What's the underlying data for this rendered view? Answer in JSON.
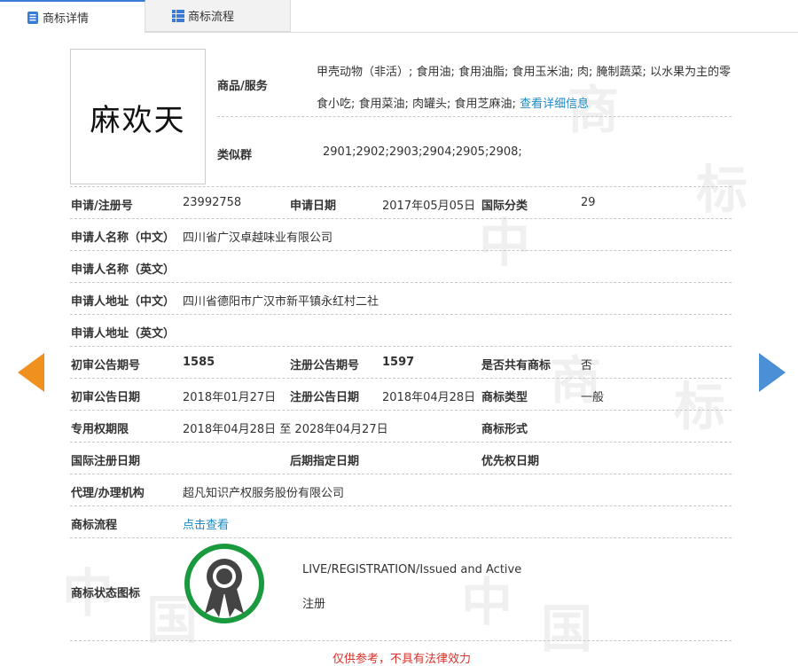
{
  "tabs": [
    {
      "label": "商标详情",
      "icon": "document-icon"
    },
    {
      "label": "商标流程",
      "icon": "list-icon"
    }
  ],
  "logo": {
    "text": "麻欢天"
  },
  "watermark": {
    "chars": [
      "中",
      "国",
      "商",
      "标"
    ]
  },
  "goods": {
    "label": "商品/服务",
    "text": "甲壳动物（非活）; 食用油; 食用油脂; 食用玉米油; 肉; 腌制蔬菜; 以水果为主的零食小吃; 食用菜油; 肉罐头; 食用芝麻油;",
    "link": "查看详细信息"
  },
  "similar": {
    "label": "类似群",
    "value": "2901;2902;2903;2904;2905;2908;"
  },
  "rows": {
    "reg_no": {
      "label": "申请/注册号",
      "value": "23992758"
    },
    "app_date": {
      "label": "申请日期",
      "value": "2017年05月05日"
    },
    "intl_class": {
      "label": "国际分类",
      "value": "29"
    },
    "applicant_cn": {
      "label": "申请人名称（中文）",
      "value": "四川省广汉卓越味业有限公司"
    },
    "applicant_en": {
      "label": "申请人名称（英文）",
      "value": ""
    },
    "address_cn": {
      "label": "申请人地址（中文）",
      "value": "四川省德阳市广汉市新平镇永红村二社"
    },
    "address_en": {
      "label": "申请人地址（英文）",
      "value": ""
    },
    "prelim_no": {
      "label": "初审公告期号",
      "value": "1585"
    },
    "reg_pub_no": {
      "label": "注册公告期号",
      "value": "1597"
    },
    "shared": {
      "label": "是否共有商标",
      "value": "否"
    },
    "prelim_date": {
      "label": "初审公告日期",
      "value": "2018年01月27日"
    },
    "reg_pub_date": {
      "label": "注册公告日期",
      "value": "2018年04月28日"
    },
    "mark_type": {
      "label": "商标类型",
      "value": "一般"
    },
    "exclusive": {
      "label": "专用权期限",
      "value": "2018年04月28日 至 2028年04月27日"
    },
    "mark_form": {
      "label": "商标形式",
      "value": ""
    },
    "intl_reg_date": {
      "label": "国际注册日期",
      "value": ""
    },
    "later_date": {
      "label": "后期指定日期",
      "value": ""
    },
    "priority_date": {
      "label": "优先权日期",
      "value": ""
    },
    "agent": {
      "label": "代理/办理机构",
      "value": "超凡知识产权服务股份有限公司"
    },
    "flow": {
      "label": "商标流程",
      "link": "点击查看"
    },
    "status": {
      "label": "商标状态图标",
      "en": "LIVE/REGISTRATION/Issued and Active",
      "cn": "注册"
    }
  },
  "bottom_note": "仅供参考，不具有法律效力",
  "colors": {
    "accent": "#3a7bd5",
    "link": "#1a8ac8",
    "arrow_left": "#f0901e",
    "arrow_right": "#4b8fd6",
    "badge_ring": "#1a9a3e"
  }
}
